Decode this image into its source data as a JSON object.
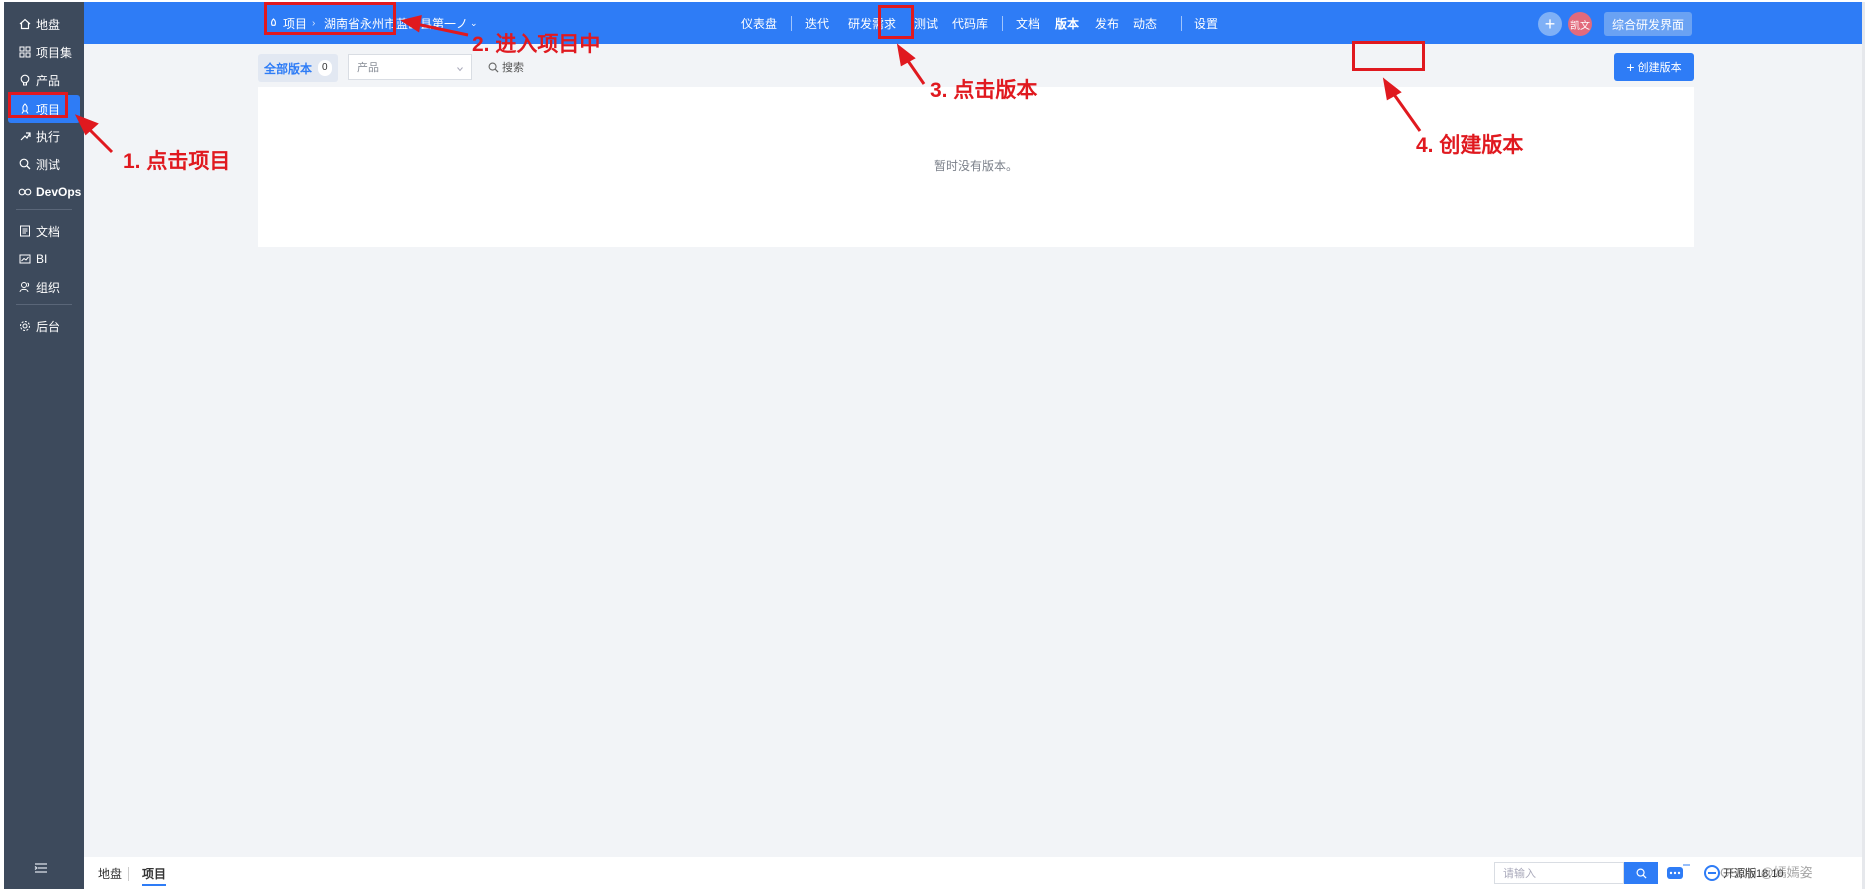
{
  "sidebar": {
    "items": [
      {
        "label": "地盘",
        "icon": "home-icon"
      },
      {
        "label": "项目集",
        "icon": "grid-icon"
      },
      {
        "label": "产品",
        "icon": "lightbulb-icon"
      },
      {
        "label": "项目",
        "icon": "rocket-icon",
        "active": true
      },
      {
        "label": "执行",
        "icon": "run-icon"
      },
      {
        "label": "测试",
        "icon": "search-bug-icon"
      },
      {
        "label": "DevOps",
        "icon": "infinity-icon"
      },
      {
        "label": "文档",
        "icon": "document-icon"
      },
      {
        "label": "BI",
        "icon": "chart-icon"
      },
      {
        "label": "组织",
        "icon": "people-icon"
      },
      {
        "label": "后台",
        "icon": "gear-icon"
      }
    ]
  },
  "header": {
    "module": "项目",
    "project_name": "湖南省永州市蓝山县第一ノ",
    "nav": [
      "仪表盘",
      "迭代",
      "研发需求",
      "测试",
      "代码库",
      "文档",
      "版本",
      "发布",
      "动态",
      "设置"
    ],
    "active_nav": "版本",
    "avatar_text": "凯文",
    "workspace_button": "综合研发界面"
  },
  "toolbar": {
    "tab_all_label": "全部版本",
    "tab_all_count": "0",
    "product_placeholder": "产品",
    "search_label": "搜索",
    "create_label": "创建版本"
  },
  "content": {
    "empty_text": "暂时没有版本。"
  },
  "footer": {
    "breadcrumb": [
      "地盘",
      "项目"
    ],
    "input_placeholder": "请输入",
    "version": "开源版18.10",
    "watermark": "CSDN @嫣嫣姿"
  },
  "annotations": {
    "step1": "1. 点击项目",
    "step2": "2. 进入项目中",
    "step3": "3. 点击版本",
    "step4": "4. 创建版本"
  },
  "colors": {
    "primary": "#2e7cf6",
    "sidebar": "#3d4a5c",
    "annotation": "#e0191f"
  }
}
